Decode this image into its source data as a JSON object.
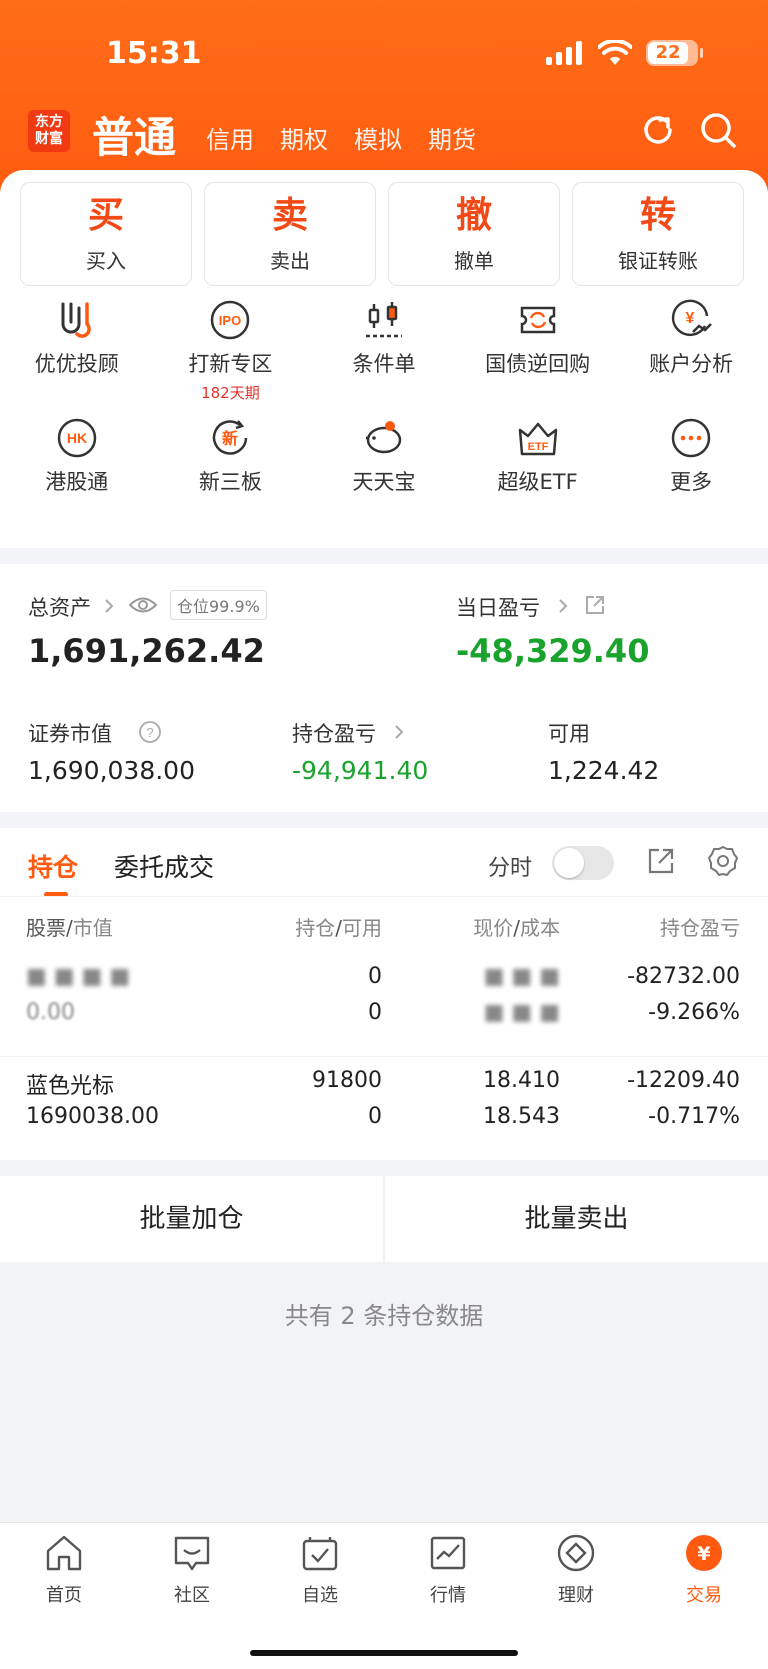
{
  "status_bar": {
    "time": "15:31",
    "battery": "22"
  },
  "header": {
    "logo_text": "东方\n财富",
    "active_tab": "普通",
    "tabs": [
      "信用",
      "期权",
      "模拟",
      "期货"
    ]
  },
  "actions": [
    {
      "char": "买",
      "label": "买入"
    },
    {
      "char": "卖",
      "label": "卖出"
    },
    {
      "char": "撤",
      "label": "撤单"
    },
    {
      "char": "转",
      "label": "银证转账"
    }
  ],
  "grid": {
    "row1": [
      {
        "label": "优优投顾",
        "icon": "youyou-icon"
      },
      {
        "label": "打新专区",
        "icon": "ipo-icon",
        "sub": "182天期",
        "icon_text": "IPO"
      },
      {
        "label": "条件单",
        "icon": "candlestick-icon"
      },
      {
        "label": "国债逆回购",
        "icon": "repo-icon"
      },
      {
        "label": "账户分析",
        "icon": "yuan-chart-icon",
        "icon_text": "¥"
      }
    ],
    "row2": [
      {
        "label": "港股通",
        "icon": "hk-icon",
        "icon_text": "HK"
      },
      {
        "label": "新三板",
        "icon": "xinsanban-icon",
        "icon_text": "新"
      },
      {
        "label": "天天宝",
        "icon": "piggy-bank-icon"
      },
      {
        "label": "超级ETF",
        "icon": "etf-icon",
        "icon_text": "ETF"
      },
      {
        "label": "更多",
        "icon": "more-icon"
      }
    ]
  },
  "assets": {
    "total_label": "总资产",
    "position_badge": "仓位99.9%",
    "total_value": "1,691,262.42",
    "daily_pl_label": "当日盈亏",
    "daily_pl_value": "-48,329.40",
    "market_value_label": "证券市值",
    "market_value": "1,690,038.00",
    "holding_pl_label": "持仓盈亏",
    "holding_pl_value": "-94,941.40",
    "available_label": "可用",
    "available_value": "1,224.42"
  },
  "holdings": {
    "tabs": [
      "持仓",
      "委托成交"
    ],
    "fenshi_label": "分时",
    "headers": {
      "stock": "股票",
      "market_value": "市值",
      "hold": "持仓",
      "avail": "可用",
      "price": "现价",
      "cost": "成本",
      "pl": "持仓盈亏"
    },
    "rows": [
      {
        "name": "■ ■ ■ ■",
        "value": "0.00",
        "hold": "0",
        "avail": "0",
        "price": "■ ■ ■",
        "cost": "■ ■ ■",
        "pl": "-82732.00",
        "pl_pct": "-9.266%"
      },
      {
        "name": "蓝色光标",
        "value": "1690038.00",
        "hold": "91800",
        "avail": "0",
        "price": "18.410",
        "cost": "18.543",
        "pl": "-12209.40",
        "pl_pct": "-0.717%"
      }
    ]
  },
  "batch": {
    "add": "批量加仓",
    "sell": "批量卖出"
  },
  "footer_note": "共有 2 条持仓数据",
  "bottom_nav": [
    {
      "label": "首页",
      "icon": "home-icon"
    },
    {
      "label": "社区",
      "icon": "community-icon"
    },
    {
      "label": "自选",
      "icon": "watchlist-icon"
    },
    {
      "label": "行情",
      "icon": "market-icon"
    },
    {
      "label": "理财",
      "icon": "wealth-icon"
    },
    {
      "label": "交易",
      "icon": "trade-icon",
      "icon_text": "¥"
    }
  ],
  "colors": {
    "brand": "#ff5a10",
    "loss": "#1aa32c",
    "accent_red": "#e5332a"
  }
}
